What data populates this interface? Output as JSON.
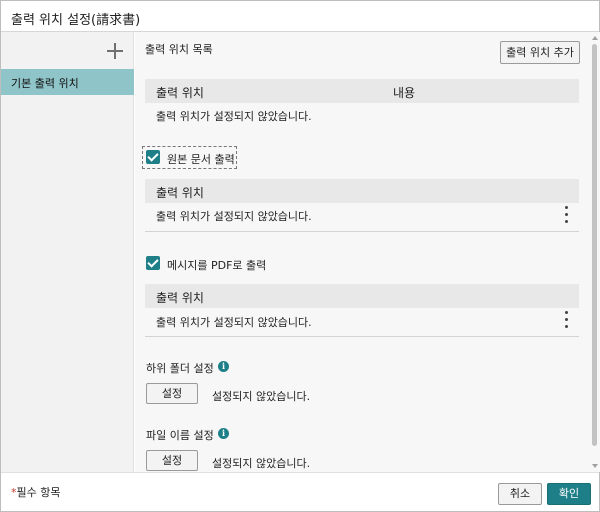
{
  "dialog": {
    "title": "출력 위치 설정(請求書)"
  },
  "sidebar": {
    "add_icon": "plus-icon",
    "items": [
      {
        "label": "기본 출력 위치",
        "selected": true
      }
    ]
  },
  "main": {
    "output_list": {
      "label": "출력 위치 목록",
      "add_button": "출력 위치 추가",
      "col_location": "출력 위치",
      "col_content": "내용",
      "empty_text": "출력 위치가 설정되지 않았습니다."
    },
    "original_output": {
      "checkbox_label": "원본 문서 출력",
      "checked": true,
      "col_location": "출력 위치",
      "empty_text": "출력 위치가 설정되지 않았습니다."
    },
    "pdf_output": {
      "checkbox_label": "메시지를 PDF로 출력",
      "checked": true,
      "col_location": "출력 위치",
      "empty_text": "출력 위치가 설정되지 않았습니다."
    },
    "subfolder": {
      "label": "하위 폴더 설정",
      "button": "설정",
      "status": "설정되지 않았습니다."
    },
    "filename": {
      "label": "파일 이름 설정",
      "button": "설정",
      "status": "설정되지 않았습니다."
    }
  },
  "footer": {
    "required_star": "*",
    "required_label": "필수 항목",
    "cancel": "취소",
    "ok": "확인"
  },
  "colors": {
    "accent": "#1f7f88",
    "sidebar_selected": "#8fc4c8"
  }
}
